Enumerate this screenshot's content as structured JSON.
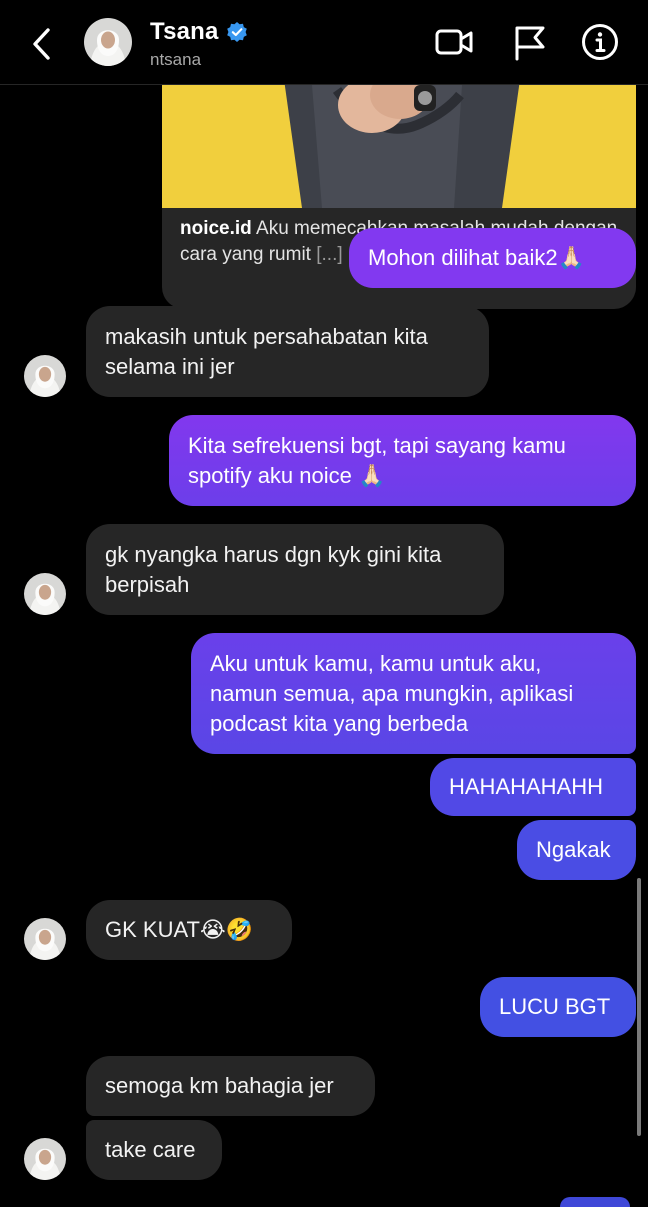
{
  "header": {
    "name": "Tsana",
    "username": "ntsana"
  },
  "link_preview": {
    "source": "noice.id",
    "text": " Aku memecahkan masalah mudah dengan cara yang rumit ",
    "more": "[...]"
  },
  "messages": [
    {
      "from": "me",
      "text": "Mohon dilihat baik2🙏🏻"
    },
    {
      "from": "them",
      "text": "makasih untuk persahabatan kita\nselama ini jer"
    },
    {
      "from": "me",
      "text": "Kita sefrekuensi bgt, tapi sayang kamu\nspotify aku noice 🙏🏻"
    },
    {
      "from": "them",
      "text": "gk nyangka harus dgn kyk gini kita\nberpisah"
    },
    {
      "from": "me",
      "text": "Aku untuk kamu, kamu untuk aku,\nnamun semua, apa mungkin, aplikasi\npodcast kita yang berbeda"
    },
    {
      "from": "me",
      "text": "HAHAHAHAHH"
    },
    {
      "from": "me",
      "text": "Ngakak"
    },
    {
      "from": "them",
      "text": "GK KUAT😭🤣"
    },
    {
      "from": "me",
      "text": "LUCU BGT"
    },
    {
      "from": "them",
      "text": "semoga km bahagia jer"
    },
    {
      "from": "them",
      "text": "take care"
    }
  ],
  "colors": {
    "background": "#000000",
    "incoming_bubble": "#262626",
    "outgoing_gradient_top": "#8a3df0",
    "outgoing_gradient_bottom": "#3f52e3",
    "verified_badge": "#3897f0",
    "secondary_text": "#a8a8a8"
  },
  "icons": [
    "back-arrow-icon",
    "verified-badge-icon",
    "video-call-icon",
    "flag-icon",
    "info-icon"
  ]
}
